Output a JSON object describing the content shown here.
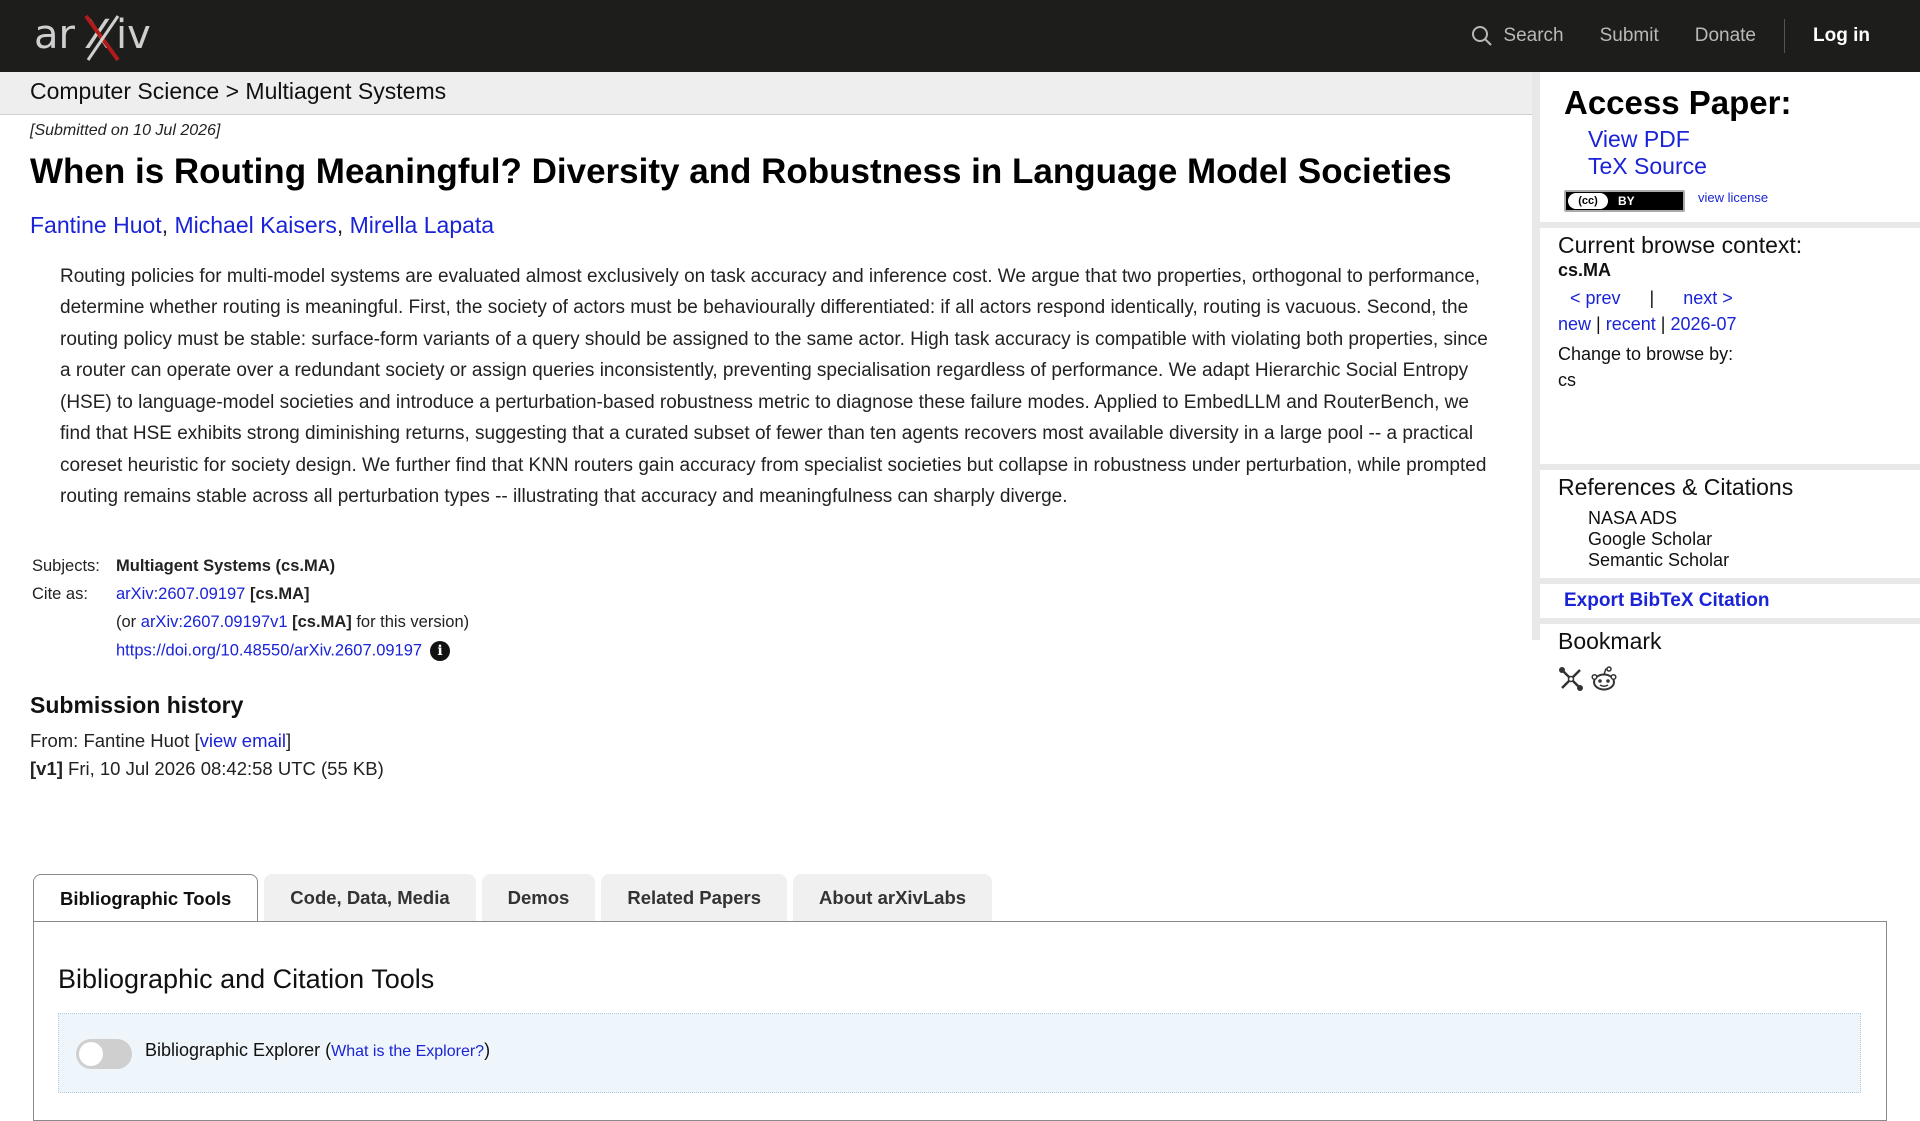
{
  "header": {
    "logo_text": "arXiv",
    "search_label": "Search",
    "submit_label": "Submit",
    "donate_label": "Donate",
    "login_label": "Log in"
  },
  "breadcrumb": {
    "text": "Computer Science > Multiagent Systems"
  },
  "paper": {
    "submitted": "[Submitted on 10 Jul 2026]",
    "title": "When is Routing Meaningful? Diversity and Robustness in Language Model Societies",
    "authors": [
      "Fantine Huot",
      "Michael Kaisers",
      "Mirella Lapata"
    ],
    "abstract": "Routing policies for multi-model systems are evaluated almost exclusively on task accuracy and inference cost. We argue that two properties, orthogonal to performance, determine whether routing is meaningful. First, the society of actors must be behaviourally differentiated: if all actors respond identically, routing is vacuous. Second, the routing policy must be stable: surface-form variants of a query should be assigned to the same actor. High task accuracy is compatible with violating both properties, since a router can operate over a redundant society or assign queries inconsistently, preventing specialisation regardless of performance. We adapt Hierarchic Social Entropy (HSE) to language-model societies and introduce a perturbation-based robustness metric to diagnose these failure modes. Applied to EmbedLLM and RouterBench, we find that HSE exhibits strong diminishing returns, suggesting that a curated subset of fewer than ten agents recovers most available diversity in a large pool -- a practical coreset heuristic for society design. We further find that KNN routers gain accuracy from specialist societies but collapse in robustness under perturbation, while prompted routing remains stable across all perturbation types -- illustrating that accuracy and meaningfulness can sharply diverge."
  },
  "meta": {
    "subjects_label": "Subjects:",
    "subjects_value": "Multiagent Systems (cs.MA)",
    "cite_label": "Cite as:",
    "cite_id": "arXiv:2607.09197",
    "cite_cat": "[cs.MA]",
    "version_prefix": "(or",
    "version_id": "arXiv:2607.09197v1",
    "version_cat": "[cs.MA]",
    "version_suffix": "for this version)",
    "doi": "https://doi.org/10.48550/arXiv.2607.09197"
  },
  "history": {
    "heading": "Submission history",
    "from_prefix": "From: Fantine Huot [",
    "view_email": "view email",
    "from_suffix": "]",
    "version_tag": "[v1]",
    "version_info": "Fri, 10 Jul 2026 08:42:58 UTC (55 KB)"
  },
  "tabs": [
    {
      "label": "Bibliographic Tools",
      "active": true
    },
    {
      "label": "Code, Data, Media",
      "active": false
    },
    {
      "label": "Demos",
      "active": false
    },
    {
      "label": "Related Papers",
      "active": false
    },
    {
      "label": "About arXivLabs",
      "active": false
    }
  ],
  "panel": {
    "heading": "Bibliographic and Citation Tools",
    "explorer_label": "Bibliographic Explorer",
    "explorer_open": "(",
    "explorer_link": "What is the Explorer?",
    "explorer_close": ")"
  },
  "sidebar": {
    "access_heading": "Access Paper:",
    "view_pdf": "View PDF",
    "tex_source": "TeX Source",
    "cc_text": "(cc)",
    "by_text": "BY",
    "view_license": "view license",
    "browse_heading": "Current browse context:",
    "browse_context": "cs.MA",
    "prev": "< prev",
    "pipe": "|",
    "next": "next >",
    "new": "new",
    "recent": "recent",
    "month": "2026-07",
    "change_label": "Change to browse by:",
    "change_cs": "cs",
    "refs_heading": "References & Citations",
    "nasa_ads": "NASA ADS",
    "google_scholar": "Google Scholar",
    "semantic_scholar": "Semantic Scholar",
    "export_bibtex": "Export BibTeX Citation",
    "bookmark_heading": "Bookmark"
  }
}
